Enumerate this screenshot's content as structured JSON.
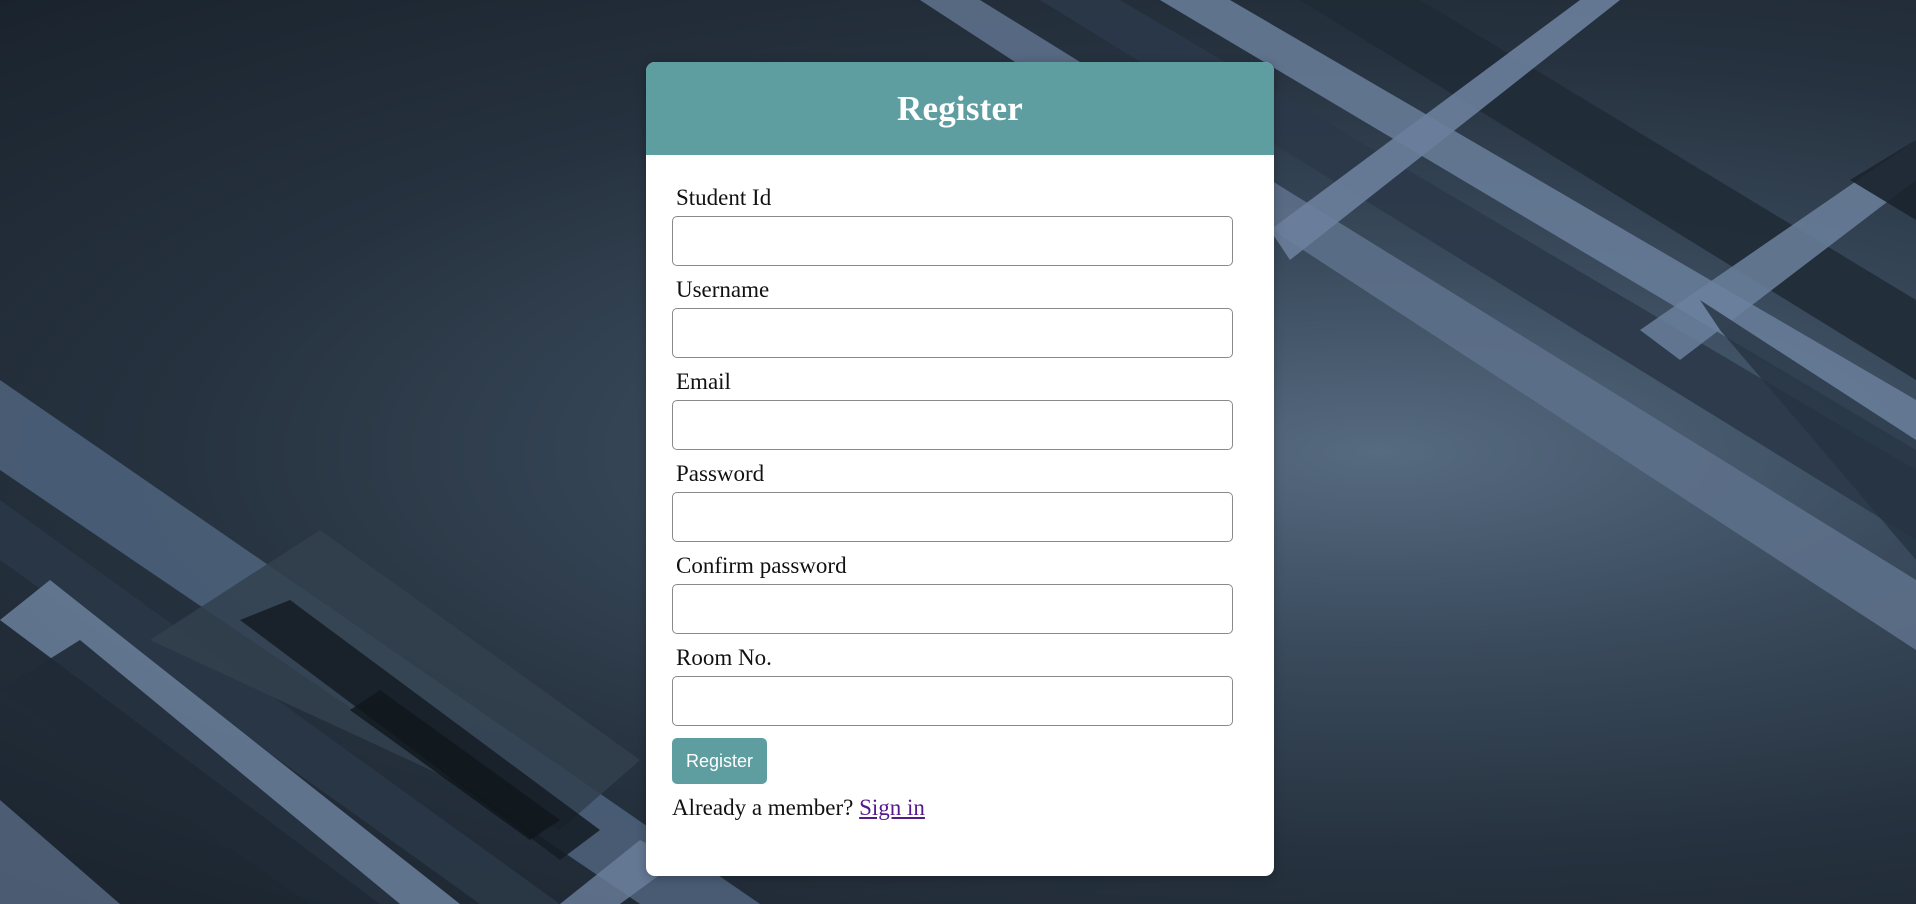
{
  "page": {
    "background_colors": [
      "#1a232d",
      "#26323f",
      "#3a4b5d",
      "#566a80"
    ],
    "accent_color": "#5f9ea0",
    "link_color": "#551a8b"
  },
  "form": {
    "title": "Register",
    "fields": [
      {
        "label": "Student Id",
        "value": "",
        "placeholder": ""
      },
      {
        "label": "Username",
        "value": "",
        "placeholder": ""
      },
      {
        "label": "Email",
        "value": "",
        "placeholder": ""
      },
      {
        "label": "Password",
        "value": "",
        "placeholder": ""
      },
      {
        "label": "Confirm password",
        "value": "",
        "placeholder": ""
      },
      {
        "label": "Room No.",
        "value": "",
        "placeholder": ""
      }
    ],
    "submit_label": "Register",
    "footer_prompt": "Already a member?",
    "signin_link": "Sign in"
  }
}
